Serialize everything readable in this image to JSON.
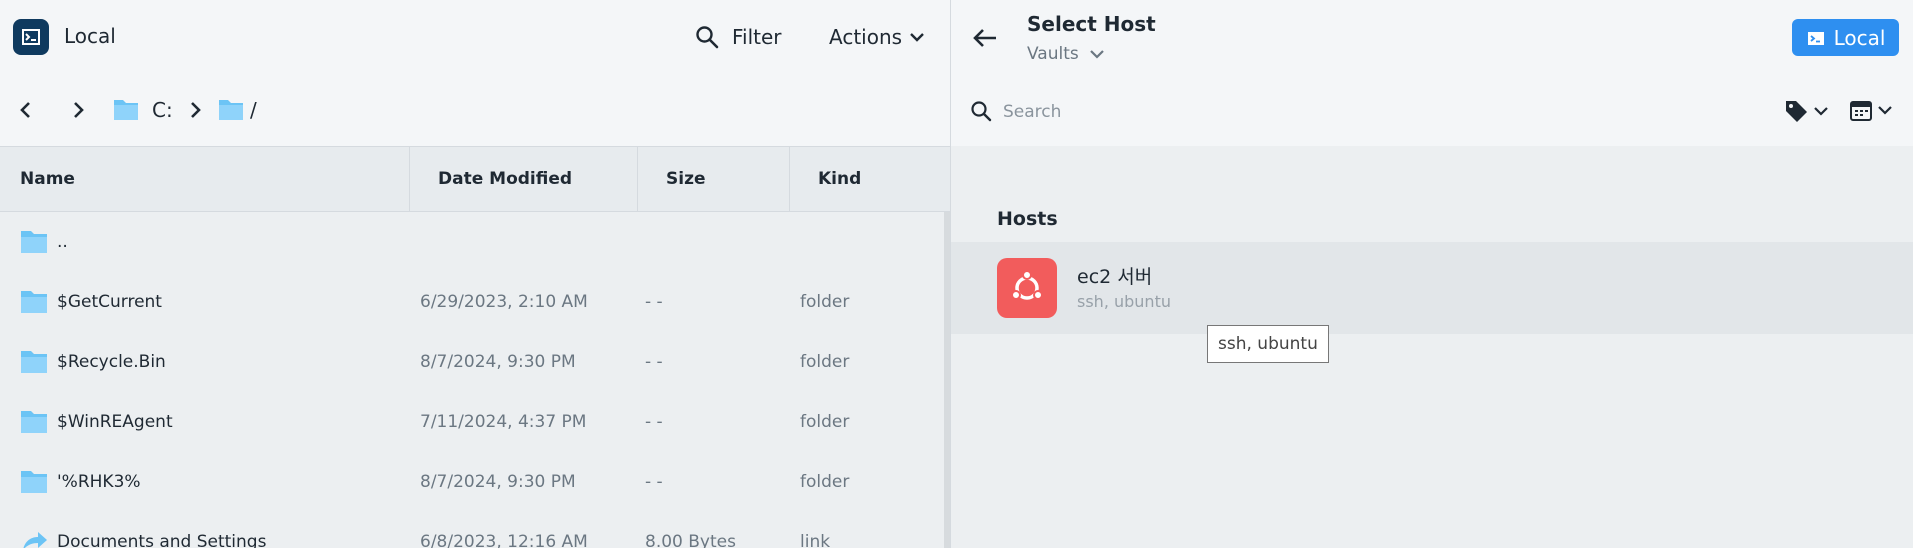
{
  "left": {
    "app_title": "Local",
    "filter_label": "Filter",
    "actions_label": "Actions",
    "breadcrumb": [
      "C:",
      "/"
    ],
    "columns": [
      "Name",
      "Date Modified",
      "Size",
      "Kind"
    ],
    "rows": [
      {
        "name": "..",
        "date": "",
        "size": "",
        "kind": "",
        "icon": "folder-icon"
      },
      {
        "name": "$GetCurrent",
        "date": "6/29/2023, 2:10 AM",
        "size": "- -",
        "kind": "folder",
        "icon": "folder-icon"
      },
      {
        "name": "$Recycle.Bin",
        "date": "8/7/2024, 9:30 PM",
        "size": "- -",
        "kind": "folder",
        "icon": "folder-icon"
      },
      {
        "name": "$WinREAgent",
        "date": "7/11/2024, 4:37 PM",
        "size": "- -",
        "kind": "folder",
        "icon": "folder-icon"
      },
      {
        "name": "'%RHK3%",
        "date": "8/7/2024, 9:30 PM",
        "size": "- -",
        "kind": "folder",
        "icon": "folder-icon"
      },
      {
        "name": "Documents and Settings",
        "date": "6/8/2023, 12:16 AM",
        "size": "8.00 Bytes",
        "kind": "link",
        "icon": "link-icon"
      }
    ]
  },
  "right": {
    "title": "Select Host",
    "vaults_label": "Vaults",
    "local_button": "Local",
    "search_placeholder": "Search",
    "hosts_section": "Hosts",
    "host": {
      "name": "ec2 서버",
      "meta": "ssh, ubuntu",
      "icon": "ubuntu-icon"
    },
    "tooltip": "ssh, ubuntu"
  },
  "colors": {
    "accent": "#2e8ff0",
    "host_avatar": "#f25c5c",
    "logo_bg": "#0f3a5f",
    "folder": "#6cc4f5"
  }
}
